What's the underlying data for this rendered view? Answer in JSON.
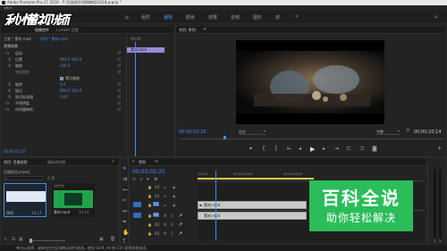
{
  "window": {
    "title": "Adobe Premiere Pro CC 2018 - F:\\百度经验\\视频教程\\2018.prproj *",
    "menu": [
      "文件(F)",
      "编辑(E)",
      "剪辑(C)",
      "序列(S)",
      "标记(M)",
      "图形(G)",
      "窗口(W)",
      "帮助(H)"
    ],
    "workspaces": [
      "组件",
      "编辑",
      "颜色",
      "效果",
      "音频",
      "图形",
      "库"
    ],
    "active_workspace": "编辑"
  },
  "watermark_logo": "秒懂视频",
  "effect_controls": {
    "tabs": [
      "效果控件",
      "Lumetri 范围",
      "源: 素材.mp4",
      "音频剪辑混合器: 序列"
    ],
    "clip_label": "主要 * 素材.mp4",
    "seq_label": "序列 * 素材.mp4",
    "section": "视频效果",
    "rows": [
      {
        "label": "运动",
        "value": ""
      },
      {
        "label": "位置",
        "value": "960.0   540.0"
      },
      {
        "label": "缩放",
        "value": "100.0"
      },
      {
        "label": "缩放宽度",
        "value": ""
      },
      {
        "label": "",
        "value": "等比缩放"
      },
      {
        "label": "旋转",
        "value": "0.0"
      },
      {
        "label": "锚点",
        "value": "960.0   540.0"
      },
      {
        "label": "防闪烁滤镜",
        "value": "0.00"
      },
      {
        "label": "不透明度",
        "value": ""
      },
      {
        "label": "时间重映射",
        "value": ""
      }
    ],
    "timecode": "00;00;02;25",
    "mini_clip": "素材.mp4",
    "mini_time": "00;00"
  },
  "program": {
    "title": "节目: 序列",
    "timecode": "00;00;02;25",
    "fit": "适合",
    "quality": "完整",
    "duration": "00;00;10;14"
  },
  "project": {
    "tabs": [
      "项目: 百度经验",
      "媒体浏览器",
      "库",
      "信息"
    ],
    "path": "百度经验.prproj",
    "item_count": "2 项",
    "items": [
      {
        "name": "序列",
        "duration": "10;14"
      },
      {
        "name": "素材.mp4",
        "duration": "10;14"
      }
    ],
    "extra_label": "媒体开始"
  },
  "timeline": {
    "title": "序列",
    "timecode": "00;00;02;25",
    "ruler": [
      ":00;00",
      "00;00;04;00",
      "00;00;08;00"
    ],
    "tracks": [
      {
        "name": "V3"
      },
      {
        "name": "V2"
      },
      {
        "name": "V1"
      },
      {
        "name": "A1"
      },
      {
        "name": "A2"
      },
      {
        "name": "A3"
      }
    ],
    "video_clip": "素材.mp4",
    "audio_clip": "素材.mp4"
  },
  "status": "单击以选择，或单击空白区域拖动进行框选。使用 Shift, Alt 和 Ctrl 获得其他选项。",
  "baike": {
    "title": "百科全说",
    "subtitle": "助你轻松解决"
  },
  "colors": {
    "accent": "#2d8ceb",
    "clip_purple": "#9a8bd6",
    "clip_gray": "#c9c9c9",
    "baike_green": "#2bbd5a"
  }
}
